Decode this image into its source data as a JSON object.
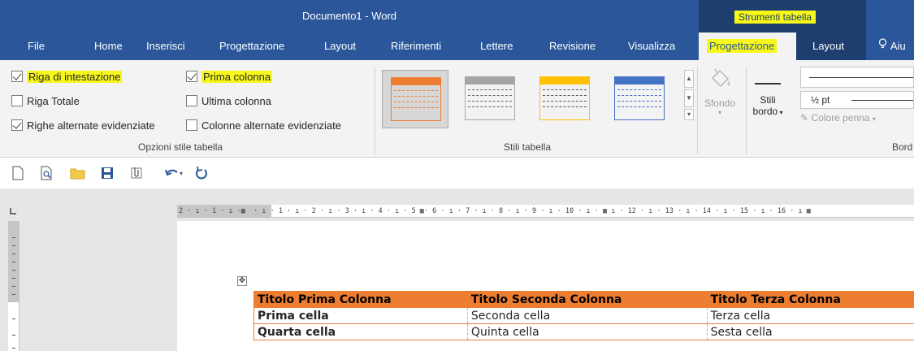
{
  "window": {
    "title": "Documento1 - Word",
    "context_group": "Strumenti tabella",
    "highlight_color": "#f7f71a",
    "brand_color": "#2b579a",
    "accent_color": "#ed7d31"
  },
  "tabs": [
    {
      "label": "File"
    },
    {
      "label": "Home"
    },
    {
      "label": "Inserisci"
    },
    {
      "label": "Progettazione"
    },
    {
      "label": "Layout"
    },
    {
      "label": "Riferimenti"
    },
    {
      "label": "Lettere"
    },
    {
      "label": "Revisione"
    },
    {
      "label": "Visualizza"
    },
    {
      "label": "Progettazione",
      "active": true
    },
    {
      "label": "Layout"
    },
    {
      "label": "Aiu",
      "icon": "lightbulb-icon"
    }
  ],
  "table_style_options": {
    "group_label": "Opzioni stile tabella",
    "options": [
      {
        "label": "Riga di intestazione",
        "checked": true,
        "highlighted": true
      },
      {
        "label": "Prima colonna",
        "checked": true,
        "highlighted": true
      },
      {
        "label": "Riga Totale",
        "checked": false
      },
      {
        "label": "Ultima colonna",
        "checked": false
      },
      {
        "label": "Righe alternate evidenziate",
        "checked": true
      },
      {
        "label": "Colonne alternate evidenziate",
        "checked": false
      }
    ]
  },
  "table_styles": {
    "group_label": "Stili tabella",
    "thumbnails": [
      {
        "color": "#ed7d31",
        "selected": true
      },
      {
        "color": "#a5a5a5"
      },
      {
        "color": "#ffc000"
      },
      {
        "color": "#4472c4"
      }
    ]
  },
  "shading": {
    "label": "Sfondo",
    "icon": "paint-bucket-icon"
  },
  "borders": {
    "styles_label": "Stili",
    "styles_label2": "bordo",
    "line_weight": "½ pt",
    "pen_color": "Colore penna",
    "group_label": "Bord"
  },
  "quick_access": {
    "icons": [
      "new-document-icon",
      "print-preview-icon",
      "open-folder-icon",
      "save-icon",
      "attach-icon",
      "undo-icon",
      "redo-icon"
    ]
  },
  "ruler": {
    "horizontal": "2 · ı · 1 · ı ·▦  · ı · 1 · ı · 2 · ı · 3 · ı · 4 · ı · 5 ▦· 6 · ı · 7 · ı · 8 · ı · 9 · ı · 10 · ı · ▦ ı · 12 · ı · 13 · ı · 14 · ı · 15 · ı · 16 · ı ▦"
  },
  "document_table": {
    "headers": [
      "Titolo Prima Colonna",
      "Titolo Seconda Colonna",
      "Titolo Terza Colonna"
    ],
    "rows": [
      [
        "Prima cella",
        "Seconda cella",
        "Terza cella"
      ],
      [
        "Quarta cella",
        "Quinta cella",
        "Sesta cella"
      ]
    ]
  }
}
